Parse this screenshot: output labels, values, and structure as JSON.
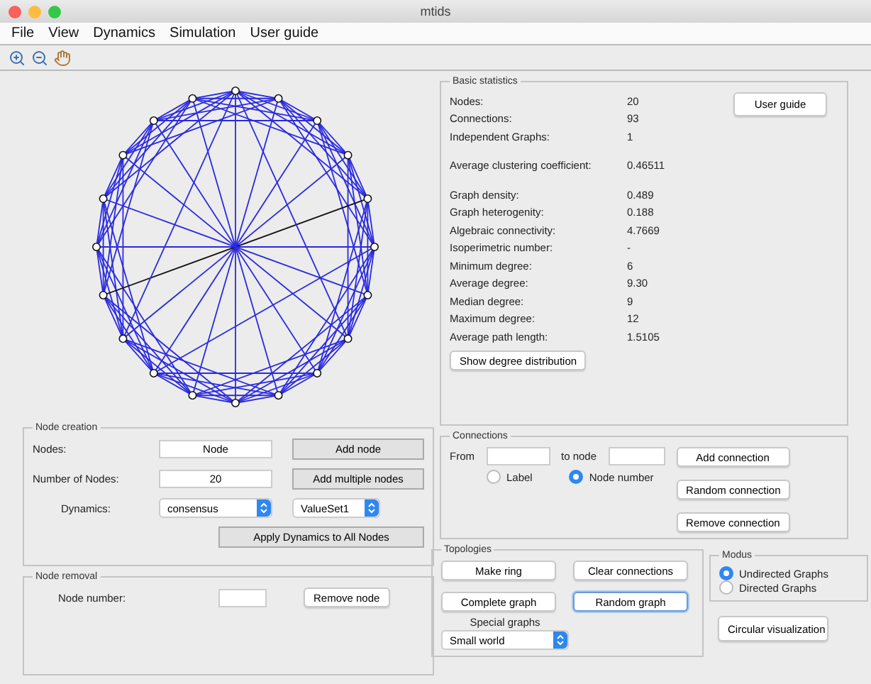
{
  "window": {
    "title": "mtids"
  },
  "menu": [
    "File",
    "View",
    "Dynamics",
    "Simulation",
    "User guide"
  ],
  "node_creation": {
    "title": "Node creation",
    "nodes_label": "Nodes:",
    "nodes_value": "Node",
    "add_node": "Add node",
    "count_label": "Number of Nodes:",
    "count_value": "20",
    "add_multiple": "Add multiple nodes",
    "dynamics_label": "Dynamics:",
    "dynamics_value": "consensus",
    "value_set": "ValueSet1",
    "apply": "Apply Dynamics to All Nodes"
  },
  "node_removal": {
    "title": "Node removal",
    "label": "Node number:",
    "button": "Remove node"
  },
  "basic_statistics": {
    "title": "Basic statistics",
    "user_guide": "User guide",
    "groups": [
      [
        {
          "label": "Nodes:",
          "value": "20"
        },
        {
          "label": "Connections:",
          "value": "93"
        },
        {
          "label": "Independent Graphs:",
          "value": "1"
        }
      ],
      [
        {
          "label": "Average clustering coefficient:",
          "value": "0.46511"
        }
      ],
      [
        {
          "label": "Graph density:",
          "value": "0.489"
        },
        {
          "label": "Graph heterogenity:",
          "value": "0.188"
        },
        {
          "label": "Algebraic connectivity:",
          "value": "4.7669"
        },
        {
          "label": "Isoperimetric number:",
          "value": "-"
        },
        {
          "label": "Minimum degree:",
          "value": "6"
        },
        {
          "label": "Average degree:",
          "value": "9.30"
        },
        {
          "label": "Median degree:",
          "value": "9"
        },
        {
          "label": "Maximum degree:",
          "value": "12"
        },
        {
          "label": "Average path length:",
          "value": "1.5105"
        }
      ]
    ],
    "show_degree": "Show degree distribution"
  },
  "connections": {
    "title": "Connections",
    "from_label": "From",
    "to_label": "to node",
    "radios": [
      {
        "label": "Label",
        "selected": false
      },
      {
        "label": "Node number",
        "selected": true
      }
    ],
    "buttons": [
      "Add connection",
      "Random connection",
      "Remove connection"
    ]
  },
  "topologies": {
    "title": "Topologies",
    "buttons": [
      {
        "label": "Make ring",
        "focused": false
      },
      {
        "label": "Clear connections",
        "focused": false
      },
      {
        "label": "Complete graph",
        "focused": false
      },
      {
        "label": "Random graph",
        "focused": true
      }
    ],
    "special_label": "Special graphs",
    "special_value": "Small world"
  },
  "modus": {
    "title": "Modus",
    "radios": [
      {
        "label": "Undirected Graphs",
        "selected": true
      },
      {
        "label": "Directed Graphs",
        "selected": false
      }
    ]
  },
  "circular_button": "Circular visualization"
}
